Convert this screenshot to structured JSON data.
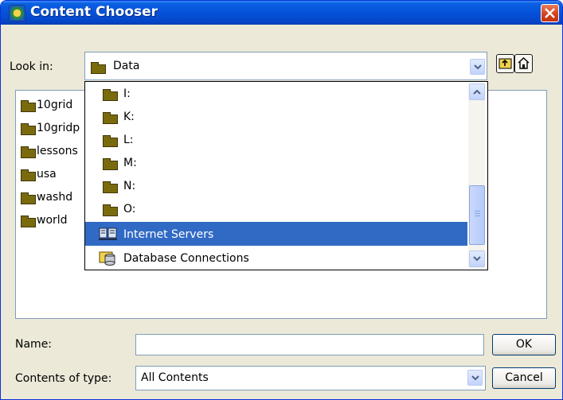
{
  "window": {
    "title": "Content Chooser"
  },
  "look_in": {
    "label": "Look in:",
    "value": "Data"
  },
  "file_list": {
    "items": [
      "10grid",
      "10gridp",
      "lessons",
      "usa",
      "washd",
      "world"
    ]
  },
  "look_in_dropdown": {
    "items": [
      {
        "label": "I:",
        "icon": "folder-icon"
      },
      {
        "label": "K:",
        "icon": "folder-icon"
      },
      {
        "label": "L:",
        "icon": "folder-icon"
      },
      {
        "label": "M:",
        "icon": "folder-icon"
      },
      {
        "label": "N:",
        "icon": "folder-icon"
      },
      {
        "label": "O:",
        "icon": "folder-icon"
      },
      {
        "label": "Internet Servers",
        "icon": "internet-servers-icon",
        "selected": true
      },
      {
        "label": "Database Connections",
        "icon": "database-connections-icon"
      }
    ]
  },
  "name_field": {
    "label": "Name:",
    "value": ""
  },
  "type_field": {
    "label": "Contents of type:",
    "value": "All Contents"
  },
  "buttons": {
    "ok": "OK",
    "cancel": "Cancel"
  },
  "colors": {
    "selection": "#316ac5",
    "titlebar": "#0552d8",
    "dialog_bg": "#ece9d8"
  }
}
